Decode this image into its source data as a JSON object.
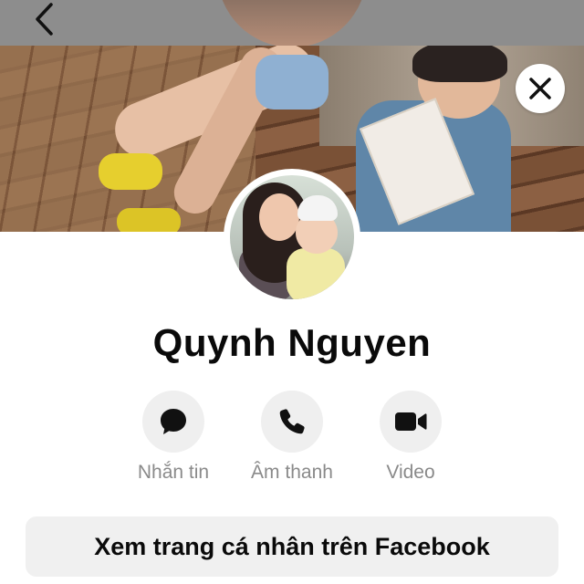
{
  "header": {
    "back_icon": "chevron-left-icon"
  },
  "cover": {
    "close_icon": "close-icon"
  },
  "profile": {
    "name": "Quynh Nguyen"
  },
  "actions": [
    {
      "label": "Nhắn tin",
      "icon": "message-bubble-icon"
    },
    {
      "label": "Âm thanh",
      "icon": "phone-icon"
    },
    {
      "label": "Video",
      "icon": "video-camera-icon"
    }
  ],
  "facebook_button": {
    "label": "Xem trang cá nhân trên Facebook"
  },
  "colors": {
    "top_bar": "#8d8d8d",
    "action_circle": "#efefef",
    "label_gray": "#8a8a8a",
    "button_bg": "#f0f0f0"
  }
}
